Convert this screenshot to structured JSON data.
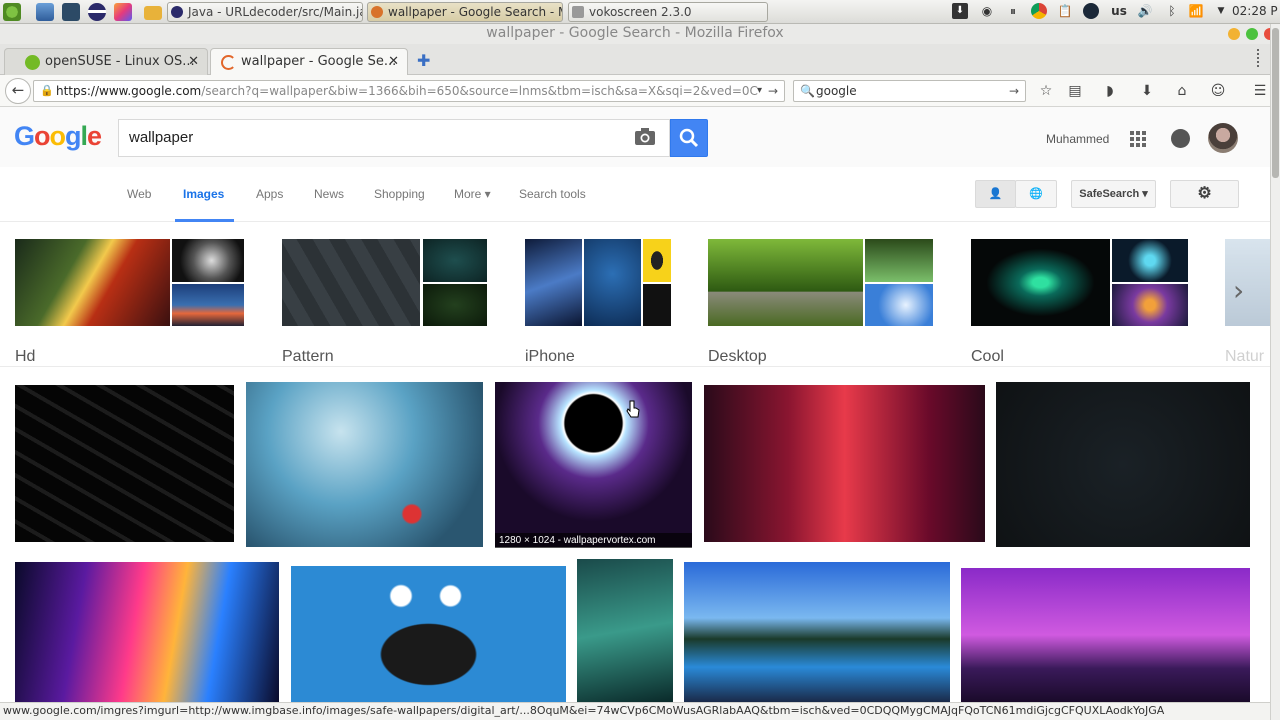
{
  "taskbar": {
    "tasks": [
      {
        "label": "Java - URLdecoder/src/Main.ja"
      },
      {
        "label": "wallpaper - Google Search - M"
      },
      {
        "label": "vokoscreen 2.3.0"
      }
    ],
    "keyboard": "us",
    "clock": "02:28 P"
  },
  "window": {
    "title": "wallpaper - Google Search - Mozilla Firefox"
  },
  "tabs": [
    {
      "label": "openSUSE - Linux OS..."
    },
    {
      "label": "wallpaper - Google Se..."
    }
  ],
  "nav": {
    "url": "https://www.google.com/search?q=wallpaper&biw=1366&bih=650&source=lnms&tbm=isch&sa=X&sqi=2&ved=0C",
    "url_host": "https://www.google.com",
    "url_rest": "/search?q=wallpaper&biw=1366&bih=650&source=lnms&tbm=isch&sa=X&sqi=2&ved=0C",
    "search_engine_query": "google"
  },
  "google": {
    "logo": "Google",
    "query": "wallpaper",
    "user": "Muhammed",
    "tabs": [
      "Web",
      "Images",
      "Apps",
      "News",
      "Shopping",
      "More ▾",
      "Search tools"
    ],
    "safesearch": "SafeSearch ▾"
  },
  "related": [
    "Hd",
    "Pattern",
    "iPhone",
    "Desktop",
    "Cool",
    "Natur"
  ],
  "result_caption": "1280 × 1024 - wallpapervortex.com",
  "status": "www.google.com/imgres?imgurl=http://www.imgbase.info/images/safe-wallpapers/digital_art/...8OquM&ei=74wCVp6CMoWusAGRlabAAQ&tbm=isch&ved=0CDQQMygCMAJqFQoTCN61mdiGjcgCFQUXLAodkYoJGA",
  "colors": {
    "accent": "#4285f4",
    "selected_tab": "#1a73e8"
  }
}
